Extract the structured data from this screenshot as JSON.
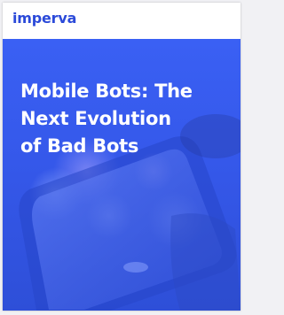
{
  "logo": {
    "text": "imperva",
    "color": "#2b4ad9"
  },
  "cover": {
    "background": "#3558ea",
    "title_lines": [
      "Mobile Bots: The",
      "Next Evolution",
      "of Bad Bots"
    ],
    "image": "smartphone-photo"
  }
}
